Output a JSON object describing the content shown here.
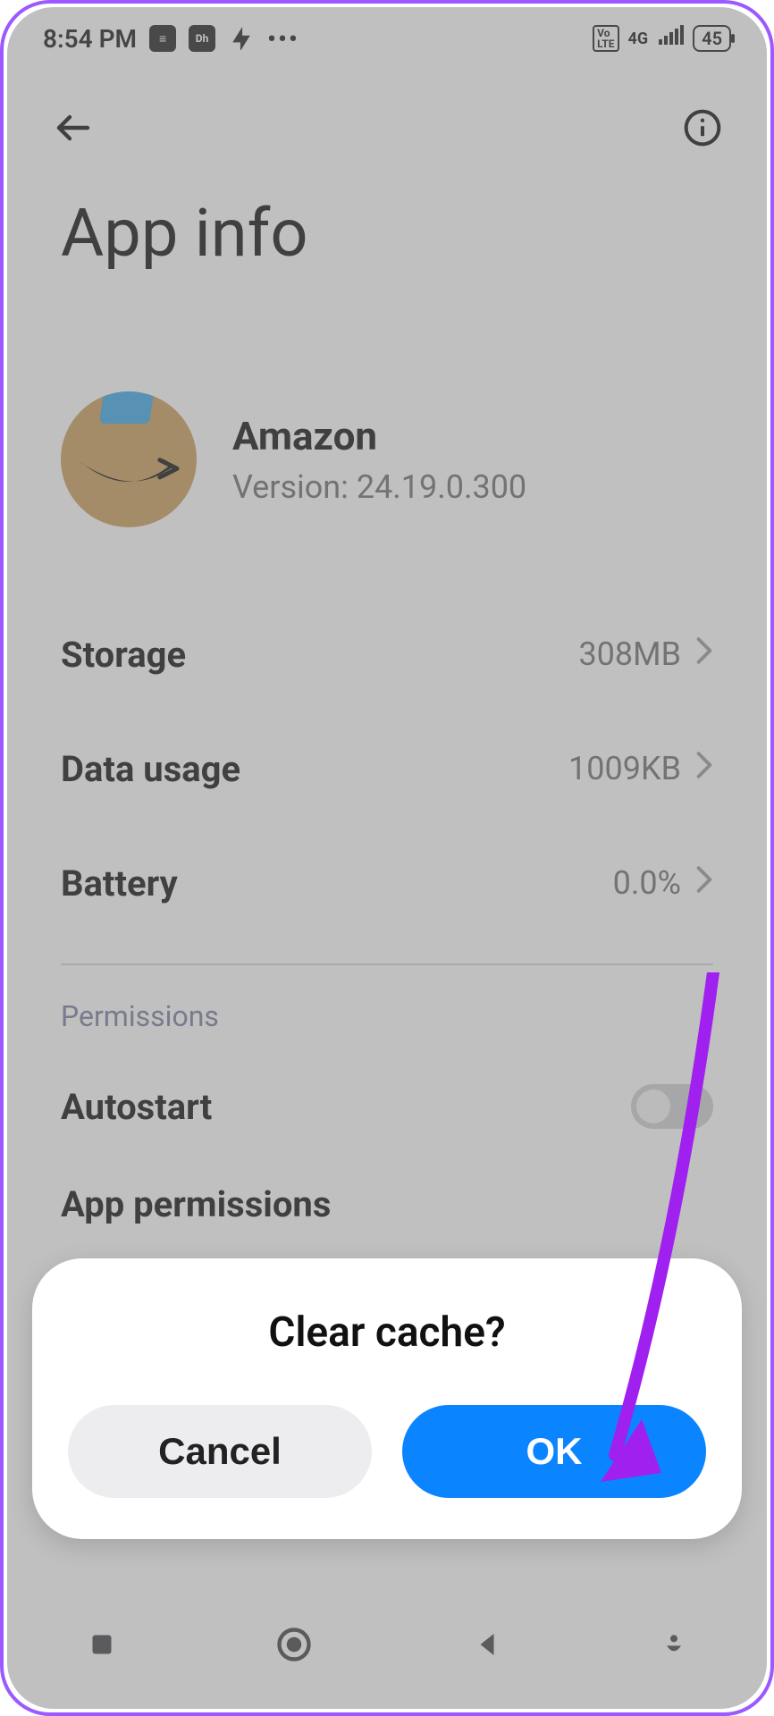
{
  "status": {
    "time": "8:54 PM",
    "net_label": "4G",
    "battery": "45"
  },
  "page": {
    "title": "App info"
  },
  "app": {
    "name": "Amazon",
    "version_label": "Version: 24.19.0.300"
  },
  "rows": {
    "storage_label": "Storage",
    "storage_value": "308MB",
    "data_label": "Data usage",
    "data_value": "1009KB",
    "battery_label": "Battery",
    "battery_value": "0.0%"
  },
  "permissions": {
    "heading": "Permissions",
    "autostart_label": "Autostart",
    "app_permissions_label": "App permissions"
  },
  "dialog": {
    "title": "Clear cache?",
    "cancel": "Cancel",
    "ok": "OK"
  }
}
